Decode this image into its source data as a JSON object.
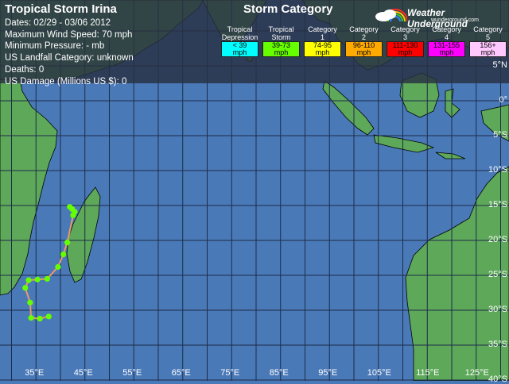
{
  "storm": {
    "title": "Tropical Storm Irina",
    "dates": "Dates: 02/29 - 03/06 2012",
    "max_wind": "Maximum Wind Speed: 70 mph",
    "min_pressure": "Minimum Pressure: - mb",
    "landfall": "US Landfall Category: unknown",
    "deaths": "Deaths: 0",
    "damage": "US Damage (Millions US $): 0"
  },
  "legend": {
    "title": "Storm Category",
    "categories": [
      {
        "line1": "Tropical",
        "line2": "Depression",
        "range1": "< 39",
        "range2": "mph",
        "color": "#00ffff"
      },
      {
        "line1": "Tropical",
        "line2": "Storm",
        "range1": "39-73",
        "range2": "mph",
        "color": "#66ff00"
      },
      {
        "line1": "Category",
        "line2": "1",
        "range1": "74-95",
        "range2": "mph",
        "color": "#ffff00"
      },
      {
        "line1": "Category",
        "line2": "2",
        "range1": "96-110",
        "range2": "mph",
        "color": "#ffaa00"
      },
      {
        "line1": "Category",
        "line2": "3",
        "range1": "111-130",
        "range2": "mph",
        "color": "#ff0000"
      },
      {
        "line1": "Category",
        "line2": "4",
        "range1": "131-155",
        "range2": "mph",
        "color": "#ff00ff"
      },
      {
        "line1": "Category",
        "line2": "5",
        "range1": "156+",
        "range2": "mph",
        "color": "#ffc8ff"
      }
    ]
  },
  "branding": {
    "name": "Weather Underground",
    "site": "wunderground.com"
  },
  "colors": {
    "ocean": "#4a79b8",
    "land": "#5ea85a",
    "coast": "#000000",
    "grid": "#1c2c48",
    "track_line": "#e89a6a",
    "track_point": "#66ff00"
  },
  "lon_labels": [
    "35°E",
    "45°E",
    "55°E",
    "65°E",
    "75°E",
    "85°E",
    "95°E",
    "105°E",
    "115°E",
    "125°E"
  ],
  "lat_labels": [
    "5°N",
    "0°",
    "5°S",
    "10°S",
    "15°S",
    "20°S",
    "25°S",
    "30°S",
    "35°S",
    "40°S"
  ],
  "track": [
    {
      "lon": 41.9,
      "lat": -15.2
    },
    {
      "lon": 42.4,
      "lat": -15.5
    },
    {
      "lon": 42.9,
      "lat": -15.9
    },
    {
      "lon": 42.6,
      "lat": -16.4
    },
    {
      "lon": 41.4,
      "lat": -20.3
    },
    {
      "lon": 40.6,
      "lat": -22.0
    },
    {
      "lon": 39.5,
      "lat": -23.8
    },
    {
      "lon": 37.3,
      "lat": -25.5
    },
    {
      "lon": 35.3,
      "lat": -25.6
    },
    {
      "lon": 33.5,
      "lat": -25.7
    },
    {
      "lon": 32.8,
      "lat": -26.8
    },
    {
      "lon": 33.8,
      "lat": -28.9
    },
    {
      "lon": 34.0,
      "lat": -31.1
    },
    {
      "lon": 35.8,
      "lat": -31.2
    },
    {
      "lon": 37.6,
      "lat": -30.9
    }
  ]
}
